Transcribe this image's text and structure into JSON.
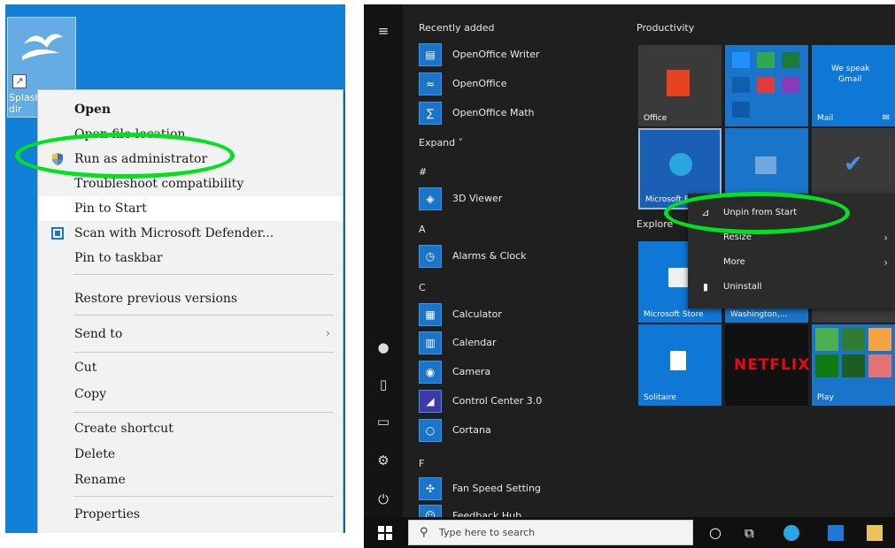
{
  "left": {
    "desktop_icon": {
      "label": "Splash\ndir"
    },
    "context_menu": {
      "items": [
        {
          "label": "Open"
        },
        {
          "label": "Open file location"
        },
        {
          "label": "Run as administrator"
        },
        {
          "label": "Troubleshoot compatibility"
        },
        {
          "label": "Pin to Start"
        },
        {
          "label": "Scan with Microsoft Defender..."
        },
        {
          "label": "Pin to taskbar"
        },
        {
          "label": "Restore previous versions"
        },
        {
          "label": "Send to"
        },
        {
          "label": "Cut"
        },
        {
          "label": "Copy"
        },
        {
          "label": "Create shortcut"
        },
        {
          "label": "Delete"
        },
        {
          "label": "Rename"
        },
        {
          "label": "Properties"
        }
      ],
      "submenu_arrow": "›"
    },
    "highlight_color": "#00e21d"
  },
  "right": {
    "recently_added_header": "Recently added",
    "recent_apps": [
      {
        "name": "OpenOffice Writer"
      },
      {
        "name": "OpenOffice"
      },
      {
        "name": "OpenOffice Math"
      }
    ],
    "expand_label": "Expand ˅",
    "sections": [
      {
        "letter": "#",
        "apps": [
          {
            "name": "3D Viewer"
          }
        ]
      },
      {
        "letter": "A",
        "apps": [
          {
            "name": "Alarms & Clock"
          }
        ]
      },
      {
        "letter": "C",
        "apps": [
          {
            "name": "Calculator"
          },
          {
            "name": "Calendar"
          },
          {
            "name": "Camera"
          },
          {
            "name": "Control Center 3.0"
          },
          {
            "name": "Cortana"
          }
        ]
      },
      {
        "letter": "F",
        "apps": [
          {
            "name": "Fan Speed Setting"
          },
          {
            "name": "Feedback Hub"
          }
        ]
      }
    ],
    "tiles_header": "Productivity",
    "explore_header": "Explore",
    "tiles": {
      "office": "Office",
      "mail_line1": "We speak",
      "mail_line2": "Gmail",
      "mail": "Mail",
      "edge": "Microsoft Edge",
      "store": "Microsoft Store",
      "weather": "Washington,...",
      "netflix": "NETFLIX",
      "solitaire": "Solitaire",
      "play": "Play"
    },
    "tile_context_menu": {
      "items": [
        {
          "label": "Unpin from Start"
        },
        {
          "label": "Resize"
        },
        {
          "label": "More"
        },
        {
          "label": "Uninstall"
        }
      ],
      "submenu_arrow": "›"
    },
    "taskbar": {
      "search_placeholder": "Type here to search"
    }
  }
}
